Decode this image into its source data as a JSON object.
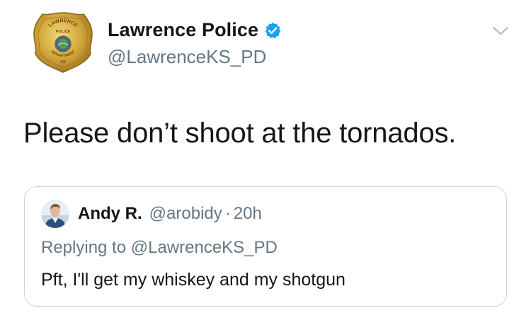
{
  "author": {
    "name": "Lawrence Police",
    "handle": "@LawrenceKS_PD",
    "verified": true,
    "avatar_icon": "police-badge-icon",
    "badge_text": {
      "top": "LAWRENCE",
      "line2": "POLICE",
      "bottom": "DEPARTMENT",
      "state": "KS"
    }
  },
  "tweet": {
    "text": "Please don’t shoot at the tornados."
  },
  "menu": {
    "icon": "chevron-down-icon"
  },
  "quoted_tweet": {
    "name": "Andy R.",
    "handle": "@arobidy",
    "separator": "·",
    "time": "20h",
    "replying_to": "Replying to @LawrenceKS_PD",
    "text": "Pft, I'll get my whiskey and my shotgun",
    "avatar_icon": "user-avatar-icon"
  },
  "colors": {
    "verified_blue": "#1da1f2",
    "secondary_text": "#657786",
    "badge_gold": "#c9a033",
    "card_border": "#ccd6dd"
  }
}
